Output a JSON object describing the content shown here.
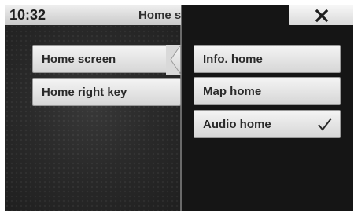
{
  "status_bar": {
    "time": "10:32",
    "title": "Home s"
  },
  "close_button": {
    "icon": "close-icon"
  },
  "left_menu": {
    "items": [
      {
        "label": "Home screen",
        "selected": true
      },
      {
        "label": "Home right key",
        "selected": false
      }
    ]
  },
  "right_menu": {
    "items": [
      {
        "label": "Info. home",
        "checked": false
      },
      {
        "label": "Map home",
        "checked": false
      },
      {
        "label": "Audio home",
        "checked": true,
        "check_icon": "checkmark-icon"
      }
    ]
  }
}
